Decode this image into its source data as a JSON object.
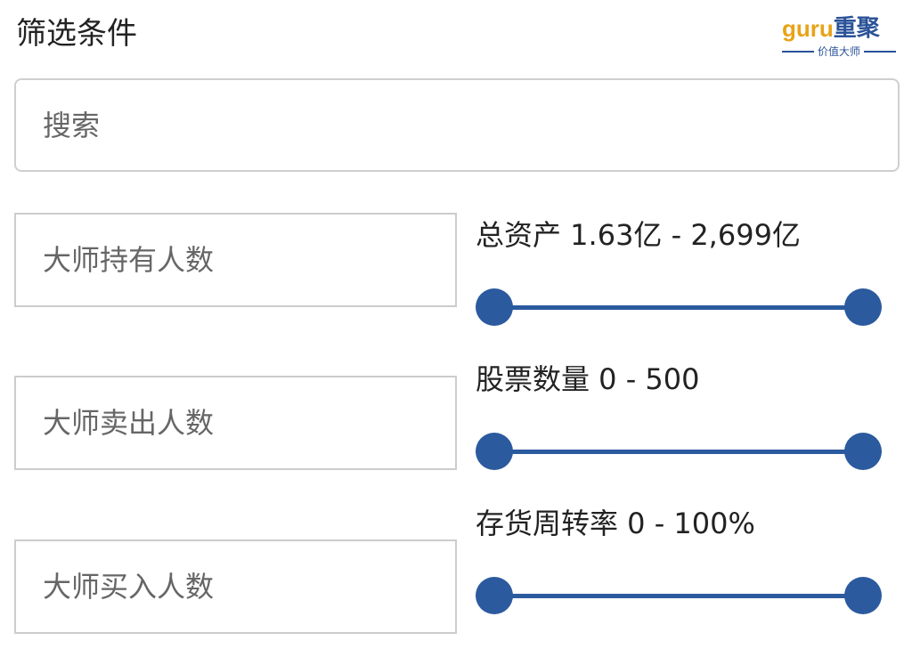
{
  "header": {
    "title": "筛选条件",
    "logo": {
      "latin": "guru",
      "chinese": "重聚",
      "tagline": "价值大师"
    }
  },
  "search": {
    "placeholder": "搜索"
  },
  "filters": [
    {
      "input_placeholder": "大师持有人数",
      "range_label": "总资产 1.63亿 - 2,699亿",
      "range": {
        "min_fraction": 0.0,
        "max_fraction": 1.0
      }
    },
    {
      "input_placeholder": "大师卖出人数",
      "range_label": "股票数量 0 - 500",
      "range": {
        "min_fraction": 0.0,
        "max_fraction": 1.0
      }
    },
    {
      "input_placeholder": "大师买入人数",
      "range_label": "存货周转率 0 - 100%",
      "range": {
        "min_fraction": 0.0,
        "max_fraction": 1.0
      }
    }
  ],
  "colors": {
    "accent": "#2b5a9e",
    "logo_gold": "#e8a317",
    "logo_blue": "#2a5298",
    "border": "#cccccc"
  }
}
